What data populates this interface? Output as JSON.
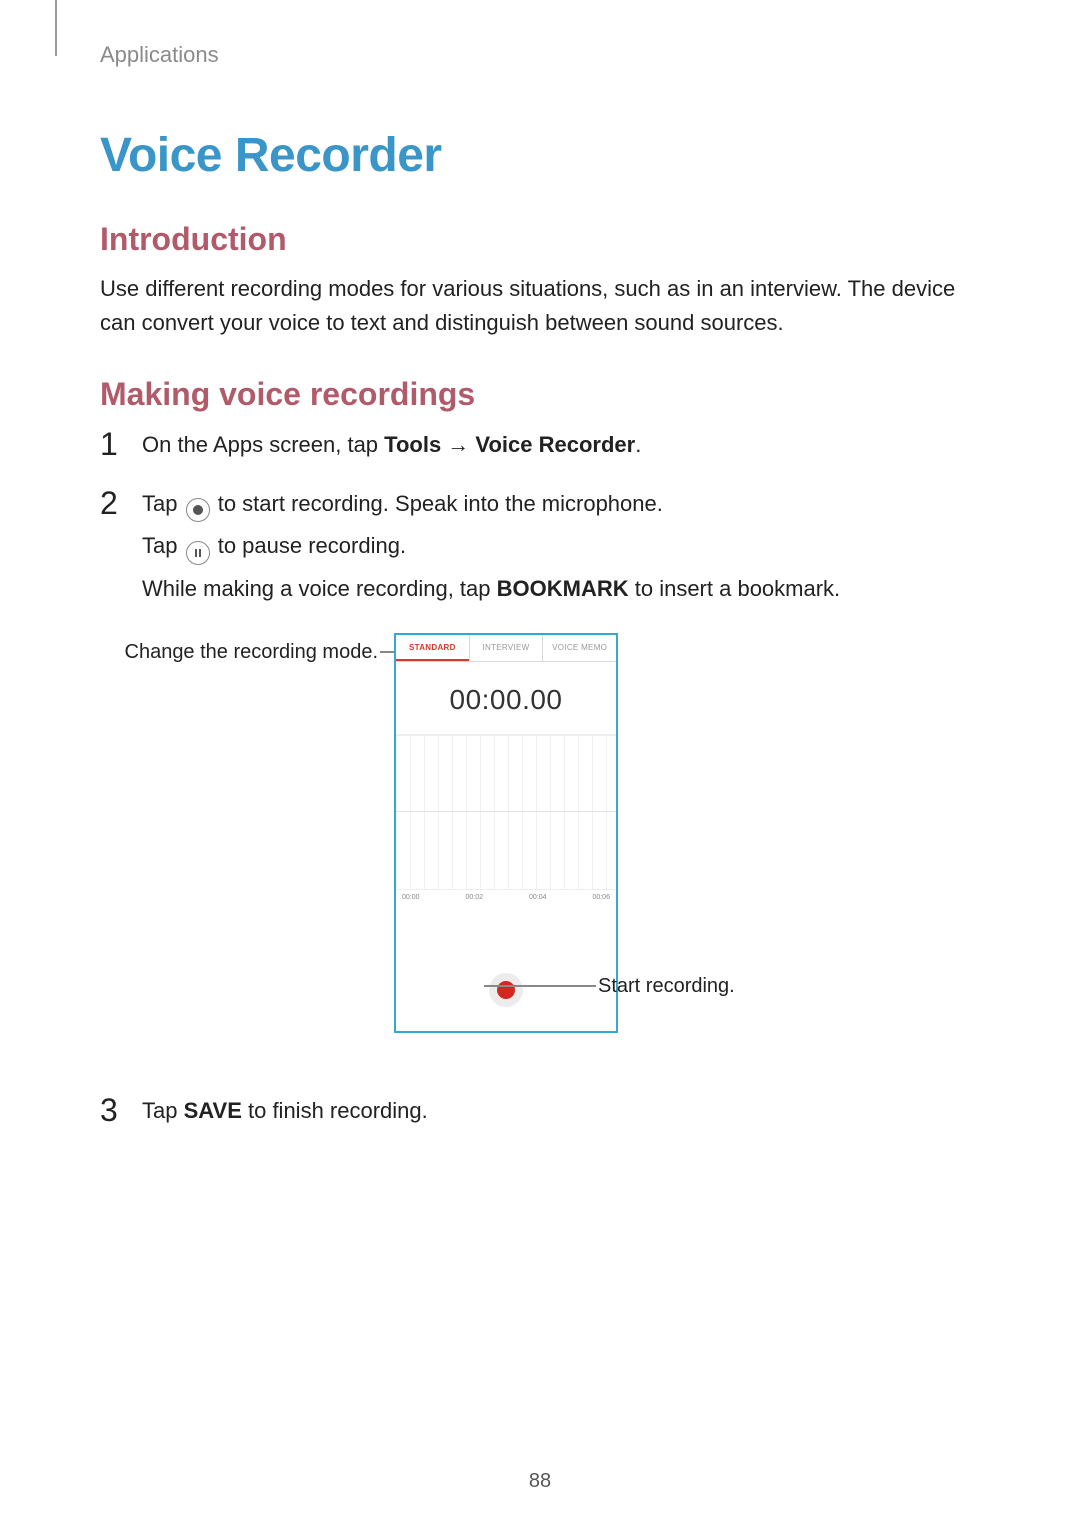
{
  "breadcrumb": "Applications",
  "title": "Voice Recorder",
  "intro_heading": "Introduction",
  "intro_body": "Use different recording modes for various situations, such as in an interview. The device can convert your voice to text and distinguish between sound sources.",
  "making_heading": "Making voice recordings",
  "step1": {
    "num": "1",
    "prefix": "On the Apps screen, tap ",
    "bold1": "Tools",
    "arrow": " → ",
    "bold2": "Voice Recorder",
    "suffix": "."
  },
  "step2": {
    "num": "2",
    "line1a": "Tap ",
    "line1b": " to start recording. Speak into the microphone.",
    "line2a": "Tap ",
    "line2b": " to pause recording.",
    "line3a": "While making a voice recording, tap ",
    "bold": "BOOKMARK",
    "line3b": " to insert a bookmark."
  },
  "step3": {
    "num": "3",
    "prefix": "Tap ",
    "bold": "SAVE",
    "suffix": " to finish recording."
  },
  "callouts": {
    "left": "Change the recording mode.",
    "right": "Start recording."
  },
  "screenshot": {
    "tabs": [
      "STANDARD",
      "INTERVIEW",
      "VOICE MEMO"
    ],
    "active_tab_index": 0,
    "timer": "00:00.00",
    "timeline": [
      "00:00",
      "00:02",
      "00:04",
      "00:06"
    ]
  },
  "page_number": "88"
}
